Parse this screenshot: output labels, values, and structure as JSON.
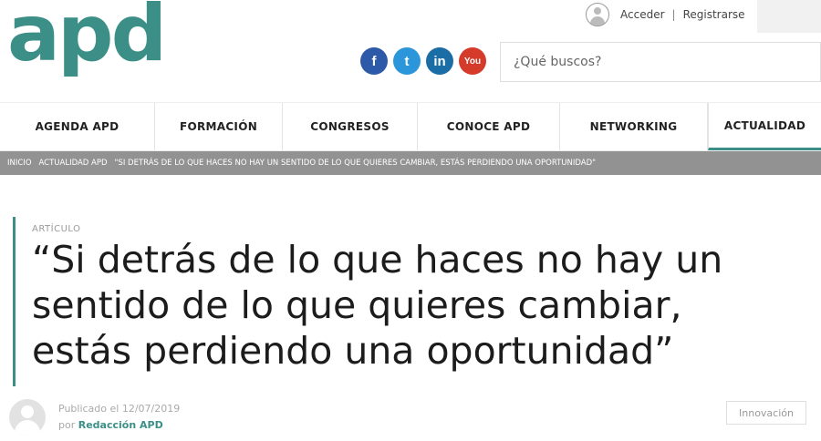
{
  "logo": "apd",
  "account": {
    "login": "Acceder",
    "separator": "|",
    "register": "Registrarse"
  },
  "social": {
    "facebook": "f",
    "twitter": "t",
    "linkedin": "in",
    "youtube": "You"
  },
  "search": {
    "placeholder": "¿Qué buscos?"
  },
  "nav": [
    "AGENDA APD",
    "FORMACIÓN",
    "CONGRESOS",
    "CONOCE APD",
    "NETWORKING",
    "ACTUALIDAD"
  ],
  "breadcrumb": [
    "INICIO",
    "ACTUALIDAD APD",
    "\"SI DETRÁS DE LO QUE HACES NO HAY UN SENTIDO DE LO QUE QUIERES CAMBIAR, ESTÁS PERDIENDO UNA OPORTUNIDAD\""
  ],
  "article": {
    "kicker": "ARTÍCULO",
    "title": "“Si detrás de lo que haces no hay un sentido de lo que quieres cambiar, estás perdiendo una oportunidad”",
    "published": "Publicado el 12/07/2019",
    "by": "por",
    "author": "Redacción APD",
    "tag": "Innovación"
  },
  "colors": {
    "brand": "#3b8f86",
    "breadcrumb_bg": "#929292"
  }
}
